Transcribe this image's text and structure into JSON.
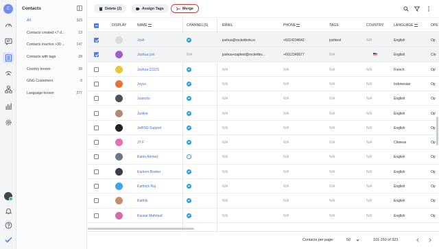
{
  "rail": {
    "avatar_letter": "C",
    "icons": [
      "dashboard-icon",
      "messages-icon",
      "contacts-icon",
      "broadcast-icon",
      "workflows-icon",
      "reports-icon",
      "settings-icon"
    ],
    "bottom_icons": [
      "user-avatar",
      "bell-icon",
      "help-icon",
      "check-icon"
    ]
  },
  "panel": {
    "title": "Contacts",
    "segments": [
      {
        "name": "All",
        "count": "323"
      },
      {
        "name": "Contacts created <7 d...",
        "count": "13"
      },
      {
        "name": "Contacts inactive >30 ...",
        "count": "147"
      },
      {
        "name": "Contacts with tags",
        "count": "28"
      },
      {
        "name": "Country known",
        "count": "39"
      },
      {
        "name": "GNG Customers",
        "count": "0"
      },
      {
        "name": "Language known",
        "count": "277"
      }
    ]
  },
  "toolbar": {
    "delete_label": "Delete (2)",
    "assign_tags_label": "Assign Tags",
    "merge_label": "Merge"
  },
  "table": {
    "headers": {
      "display": "DISPLAY",
      "name": "NAME",
      "channels": "CHANNEL(S)",
      "email": "EMAIL",
      "phone": "PHONE",
      "tags": "TAGS",
      "country": "COUNTRY",
      "language": "LANGUAGE",
      "extra": "Ope"
    },
    "rows": [
      {
        "name": "Josh",
        "email": "joshua@rocketbots.io",
        "phone": "+6014234642",
        "tags": "joshtest",
        "country": "N/A",
        "language": "English",
        "op": "Op",
        "selected": true,
        "avatar_color": "#d8dbe0",
        "channel": "telegram"
      },
      {
        "name": "Joshua Lim",
        "email": "joshua+zaptest@rocketbo...",
        "phone": "+6012345677",
        "tags": "N/A",
        "country": "flag",
        "language": "English",
        "op": "Clo",
        "selected": true,
        "avatar_color": "#a35bd0",
        "channel": "none"
      },
      {
        "name": "Joshua 2222S",
        "email": "N/A",
        "phone": "N/A",
        "tags": "N/A",
        "country": "N/A",
        "language": "French",
        "op": "Op",
        "selected": false,
        "avatar_color": "#e8c93a",
        "channel": "telegram"
      },
      {
        "name": "Joyce",
        "email": "N/A",
        "phone": "N/A",
        "tags": "N/A",
        "country": "N/A",
        "language": "Indonesian",
        "op": "Op",
        "selected": false,
        "avatar_color": "#e8733a",
        "channel": "telegram"
      },
      {
        "name": "Juancito",
        "email": "N/A",
        "phone": "N/A",
        "tags": "N/A",
        "country": "N/A",
        "language": "English",
        "op": "Op",
        "selected": false,
        "avatar_color": "#4a5260",
        "channel": "telegram"
      },
      {
        "name": "Justine",
        "email": "N/A",
        "phone": "N/A",
        "tags": "N/A",
        "country": "N/A",
        "language": "English",
        "op": "Op",
        "selected": false,
        "avatar_color": "#b58a72",
        "channel": "telegram"
      },
      {
        "name": "JwBSG Support",
        "email": "N/A",
        "phone": "N/A",
        "tags": "N/A",
        "country": "N/A",
        "language": "English",
        "op": "Op",
        "selected": false,
        "avatar_color": "#1f2226",
        "channel": "telegram"
      },
      {
        "name": "JY F",
        "email": "N/A",
        "phone": "N/A",
        "tags": "N/A",
        "country": "N/A",
        "language": "Chinese",
        "op": "Op",
        "selected": false,
        "avatar_color": "#e96fb4",
        "channel": "telegram"
      },
      {
        "name": "Karim Ahmed",
        "email": "N/A",
        "phone": "N/A",
        "tags": "N/A",
        "country": "N/A",
        "language": "English",
        "op": "Op",
        "selected": false,
        "avatar_color": "#6a7a8a",
        "channel": "webchat"
      },
      {
        "name": "Karleen Booker",
        "email": "N/A",
        "phone": "N/A",
        "tags": "N/A",
        "country": "N/A",
        "language": "English",
        "op": "Op",
        "selected": false,
        "avatar_color": "#3a3f47",
        "channel": "telegram"
      },
      {
        "name": "Karthick Raj",
        "email": "N/A",
        "phone": "N/A",
        "tags": "N/A",
        "country": "N/A",
        "language": "English",
        "op": "Op",
        "selected": false,
        "avatar_color": "#3aa8e8",
        "channel": "telegram"
      },
      {
        "name": "Karthik",
        "email": "N/A",
        "phone": "N/A",
        "tags": "N/A",
        "country": "N/A",
        "language": "English",
        "op": "Op",
        "selected": false,
        "avatar_color": "#c78f6a",
        "channel": "telegram"
      },
      {
        "name": "Kausar Mahmud",
        "email": "N/A",
        "phone": "N/A",
        "tags": "N/A",
        "country": "N/A",
        "language": "English",
        "op": "Op",
        "selected": false,
        "avatar_color": "#d96aa8",
        "channel": "telegram"
      }
    ]
  },
  "footer": {
    "rows_per_page_label": "Contacts per page:",
    "rows_per_page_value": "50",
    "range_label": "101-150 of 323"
  },
  "colors": {
    "accent": "#3b6fe0",
    "merge_border": "#d0382c",
    "telegram": "#2aa0d8"
  }
}
